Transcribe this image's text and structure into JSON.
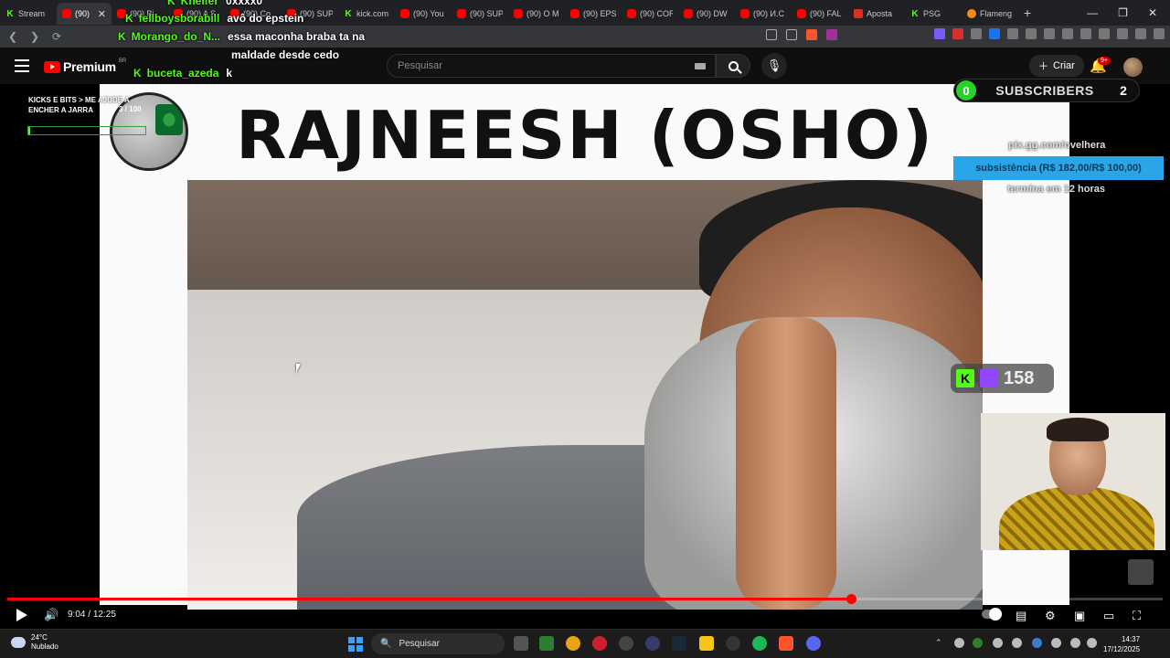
{
  "browser": {
    "tabs": [
      {
        "label": "Stream",
        "icon": "kick-icon"
      },
      {
        "label": "(90)",
        "icon": "youtube-icon",
        "active": true
      },
      {
        "label": "(90) Bi",
        "icon": "youtube-icon"
      },
      {
        "label": "(90) A S",
        "icon": "youtube-icon"
      },
      {
        "label": "(90) Co",
        "icon": "youtube-icon"
      },
      {
        "label": "(90) SUP",
        "icon": "youtube-icon"
      },
      {
        "label": "kick.com",
        "icon": "kick-icon"
      },
      {
        "label": "(90) You",
        "icon": "youtube-icon"
      },
      {
        "label": "(90) SUP",
        "icon": "youtube-icon"
      },
      {
        "label": "(90) O M",
        "icon": "youtube-icon"
      },
      {
        "label": "(90) EPS",
        "icon": "youtube-icon"
      },
      {
        "label": "(90) COR",
        "icon": "youtube-icon"
      },
      {
        "label": "(90) DW",
        "icon": "youtube-icon"
      },
      {
        "label": "(90) И.С",
        "icon": "youtube-icon"
      },
      {
        "label": "(90) FAL",
        "icon": "youtube-icon"
      },
      {
        "label": "Aposta",
        "icon": "red-icon"
      },
      {
        "label": "PSG",
        "icon": "kick-icon"
      },
      {
        "label": "Flameng",
        "icon": "orange-icon"
      }
    ],
    "new_tab": "+",
    "close_tab": "✕"
  },
  "youtube": {
    "brand": "Premium",
    "region": "BR",
    "search_placeholder": "Pesquisar",
    "create_label": "Criar",
    "notif_badge": "9+"
  },
  "chat": [
    {
      "user": "Kneifer",
      "msg": "0xxxx0"
    },
    {
      "user": "fellboysborabill",
      "msg": "avô do epstein"
    },
    {
      "user": "Morango_do_N...",
      "msg": "essa maconha braba ta na"
    },
    {
      "user": "",
      "msg": "maldade desde cedo"
    },
    {
      "user": "buceta_azeda",
      "msg": "k"
    }
  ],
  "stream": {
    "title": "RAJNEESH (OSHO)",
    "goal_text": "KICKS E BITS > ME AJUDE A ENCHER A JARRA",
    "goal_progress": "3 / 100",
    "goal_fraction": 0.03,
    "subs_left": "0",
    "subs_label": "SUBSCRIBERS",
    "subs_right": "2",
    "pix_key": "pix.gg.com/ovelhera",
    "pix_goal": "subsistência (R$ 182,00/R$ 100,00)",
    "pix_timer": "termina em 12 horas",
    "viewers": "158"
  },
  "player": {
    "current_time": "9:04",
    "duration": "12:25",
    "time_sep": " / ",
    "progress_fraction": 0.73
  },
  "taskbar": {
    "temp": "24°C",
    "weather": "Nublado",
    "search": "Pesquisar",
    "time": "14:37",
    "date": "17/12/2025"
  },
  "colors": {
    "kick_green": "#53fc18",
    "yt_red": "#ff0000",
    "pix_blue": "#2aa6e8"
  }
}
